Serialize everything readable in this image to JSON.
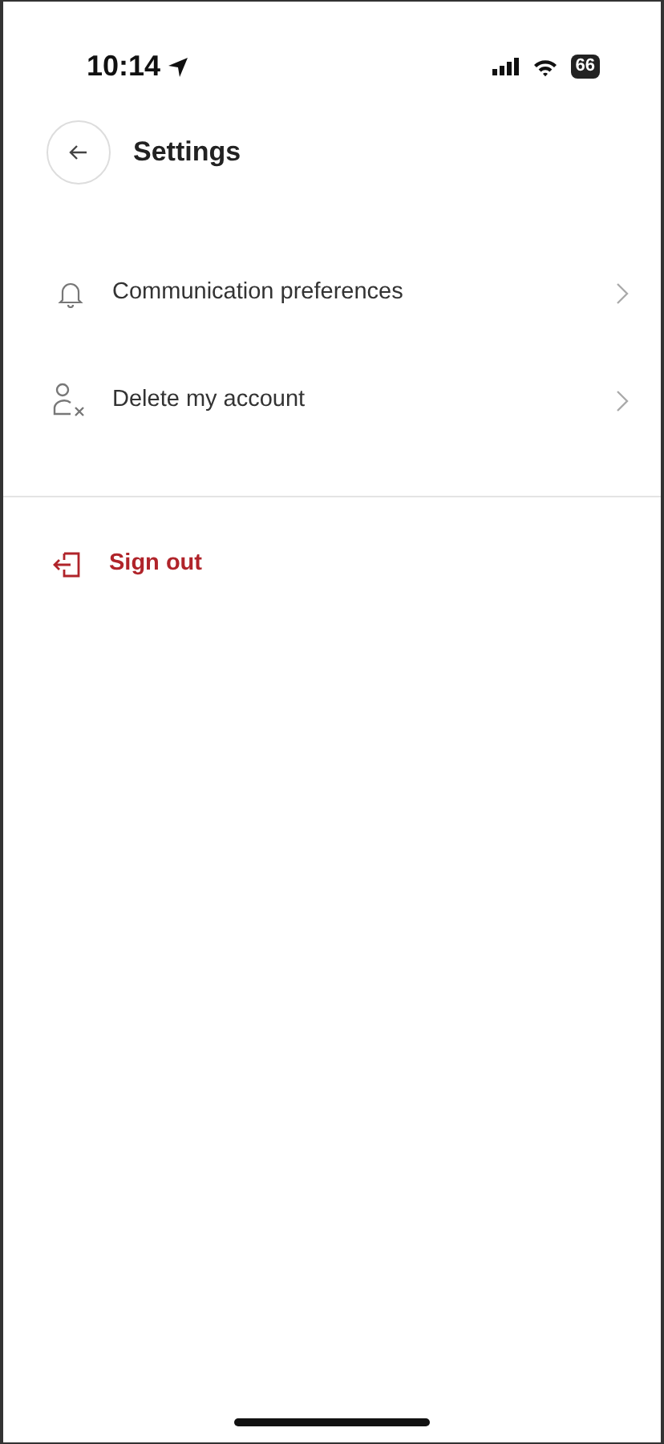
{
  "status_bar": {
    "time": "10:14",
    "battery": "66"
  },
  "header": {
    "title": "Settings"
  },
  "menu_items": [
    {
      "label": "Communication preferences",
      "has_chevron": true
    },
    {
      "label": "Delete my account",
      "has_chevron": true
    }
  ],
  "sign_out": {
    "label": "Sign out"
  }
}
